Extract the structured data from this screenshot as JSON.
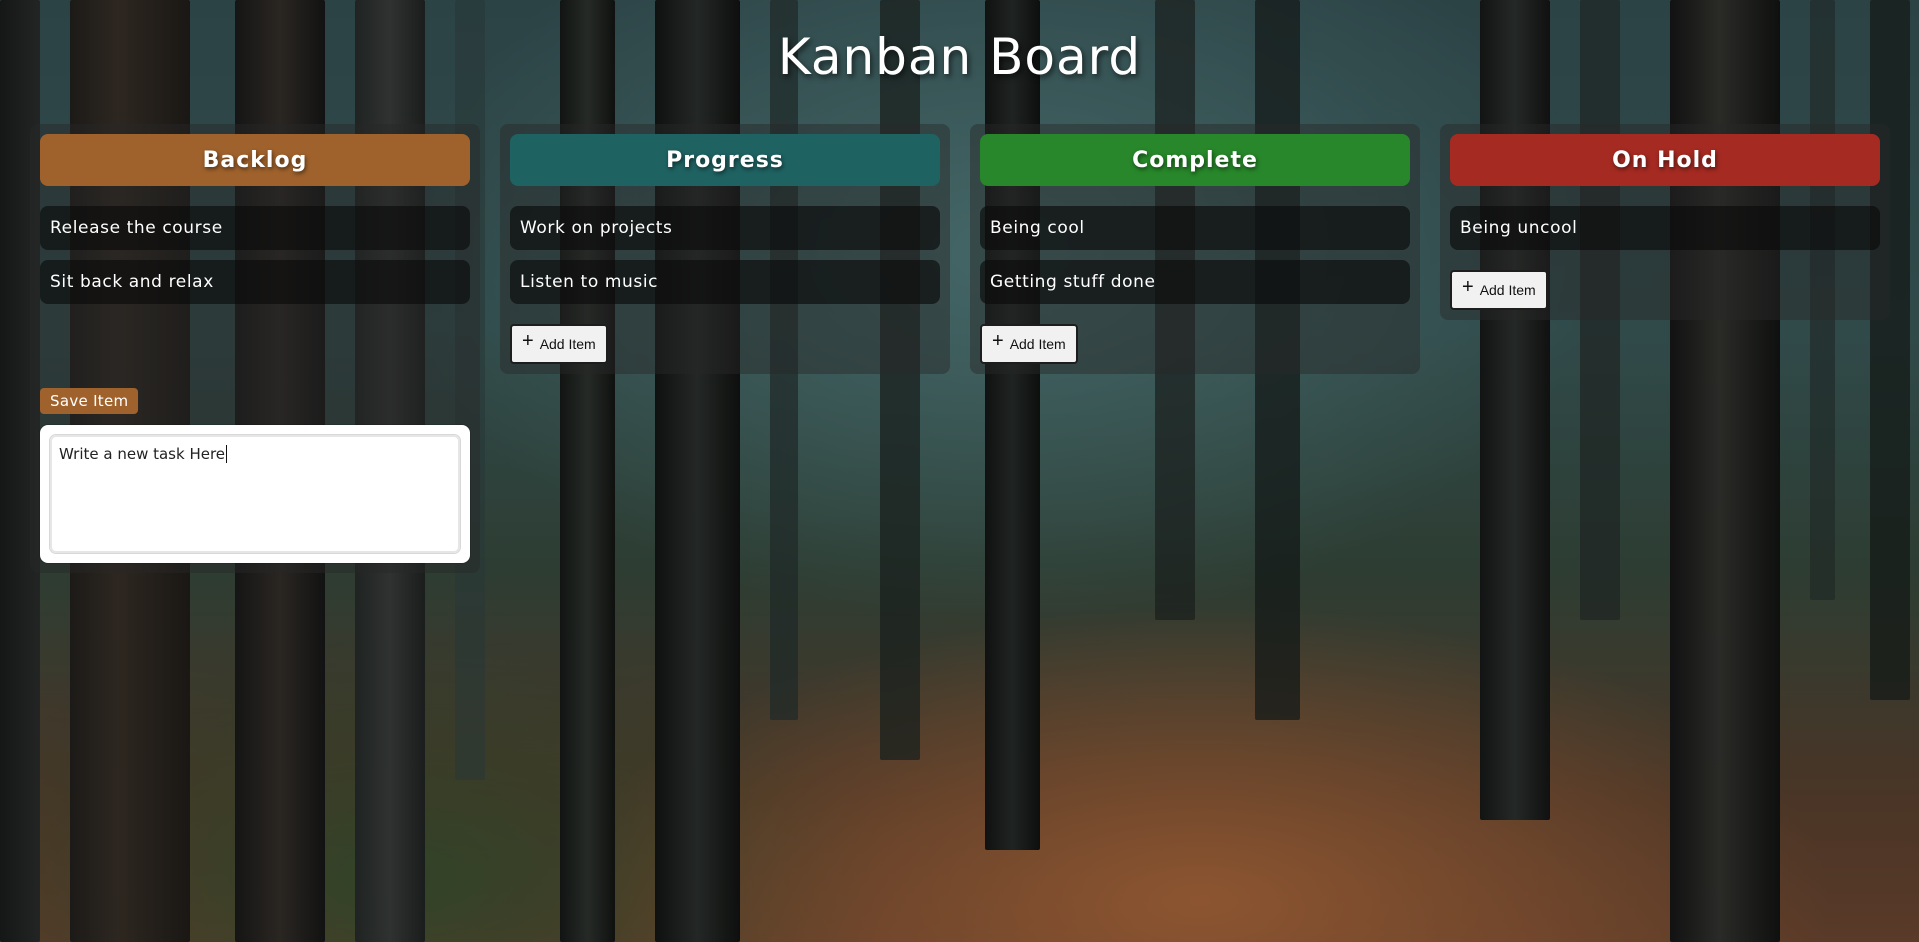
{
  "board": {
    "title": "Kanban Board",
    "columns": [
      {
        "title": "Backlog",
        "color": "#a0622c",
        "items": [
          "Release the course",
          "Sit back and relax"
        ],
        "save_label": "Save Item",
        "new_task_text": "Write a new task Here"
      },
      {
        "title": "Progress",
        "color": "#1f6262",
        "items": [
          "Work on projects",
          "Listen to music"
        ],
        "add_label": "Add Item"
      },
      {
        "title": "Complete",
        "color": "#27872a",
        "items": [
          "Being cool",
          "Getting stuff done"
        ],
        "add_label": "Add Item"
      },
      {
        "title": "On Hold",
        "color": "#a52a22",
        "items": [
          "Being uncool"
        ],
        "add_label": "Add Item"
      }
    ]
  },
  "icons": {
    "add": "plus-icon"
  }
}
